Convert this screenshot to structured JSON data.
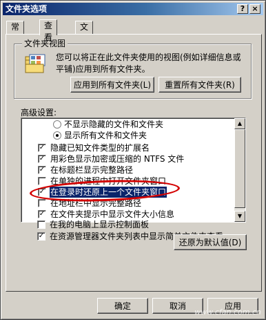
{
  "window": {
    "title": "文件夹选项",
    "help": "?",
    "close": "×"
  },
  "tabs": [
    {
      "label": "常规"
    },
    {
      "label": "查看"
    },
    {
      "label": "文件类型"
    }
  ],
  "folder_views": {
    "label": "文件夹视图",
    "description": "您可以将正在此文件夹使用的视图(例如详细信息或平铺)应用到所有文件夹。",
    "apply_all": "应用到所有文件夹(L)",
    "reset_all": "重置所有文件夹(R)"
  },
  "advanced": {
    "label": "高级设置:",
    "items": [
      {
        "type": "radio",
        "checked": false,
        "text": "不显示隐藏的文件和文件夹"
      },
      {
        "type": "radio",
        "checked": true,
        "text": "显示所有文件和文件夹"
      },
      {
        "type": "check",
        "checked": true,
        "text": "隐藏已知文件类型的扩展名"
      },
      {
        "type": "check",
        "checked": true,
        "text": "用彩色显示加密或压缩的 NTFS 文件"
      },
      {
        "type": "check",
        "checked": true,
        "text": "在标题栏显示完整路径"
      },
      {
        "type": "check",
        "checked": false,
        "text": "在单独的进程中打开文件夹窗口"
      },
      {
        "type": "check",
        "checked": true,
        "text": "在登录时还原上一个文件夹窗口"
      },
      {
        "type": "check",
        "checked": false,
        "text": "在地址栏中显示完整路径"
      },
      {
        "type": "check",
        "checked": true,
        "text": "在文件夹提示中显示文件大小信息"
      },
      {
        "type": "check",
        "checked": false,
        "text": "在我的电脑上显示控制面板"
      },
      {
        "type": "check",
        "checked": true,
        "text": "在资源管理器文件夹列表中显示简单文件夹查看"
      }
    ],
    "restore_defaults": "还原为默认值(D)"
  },
  "footer": {
    "ok": "确定",
    "cancel": "取消",
    "apply": "应用"
  },
  "watermark": "www.cfan.com.cn"
}
